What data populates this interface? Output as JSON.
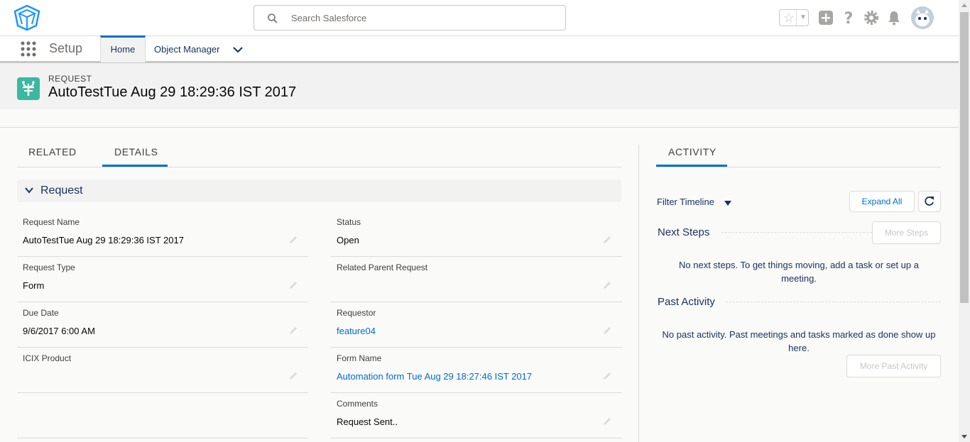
{
  "header": {
    "search_placeholder": "Search Salesforce",
    "icons": [
      "cube-logo-icon",
      "search-icon",
      "star-icon",
      "add-icon",
      "help-icon",
      "setup-gear-icon",
      "notifications-bell-icon",
      "avatar"
    ]
  },
  "context_nav": {
    "app_name": "Setup",
    "tabs": [
      {
        "label": "Home",
        "active": true
      },
      {
        "label": "Object Manager",
        "active": false
      }
    ]
  },
  "record": {
    "object_type": "REQUEST",
    "title": "AutoTestTue Aug 29 18:29:36 IST 2017"
  },
  "details_tabs": [
    {
      "label": "RELATED",
      "active": false
    },
    {
      "label": "DETAILS",
      "active": true
    }
  ],
  "section": {
    "title": "Request"
  },
  "fields_left": [
    {
      "label": "Request Name",
      "value": "AutoTestTue Aug 29 18:29:36 IST 2017",
      "link": false
    },
    {
      "label": "Request Type",
      "value": "Form",
      "link": false
    },
    {
      "label": "Due Date",
      "value": "9/6/2017 6:00 AM",
      "link": false
    },
    {
      "label": "ICIX Product",
      "value": "",
      "link": false
    }
  ],
  "fields_right": [
    {
      "label": "Status",
      "value": "Open",
      "link": false
    },
    {
      "label": "Related Parent Request",
      "value": "",
      "link": false
    },
    {
      "label": "Requestor",
      "value": "feature04",
      "link": true
    },
    {
      "label": "Form Name",
      "value": "Automation form Tue Aug 29 18:27:46 IST 2017",
      "link": true
    },
    {
      "label": "Comments",
      "value": "Request Sent..",
      "link": false
    }
  ],
  "activity": {
    "tab_label": "ACTIVITY",
    "filter_label": "Filter Timeline",
    "expand_all": "Expand All",
    "next_steps_title": "Next Steps",
    "more_steps": "More Steps",
    "next_steps_empty_line1": "No next steps. To get things moving, add a task or set up a",
    "next_steps_empty_line2": "meeting.",
    "past_activity_title": "Past Activity",
    "past_empty_line1": "No past activity. Past meetings and tasks marked as done show up",
    "past_empty_line2": "here.",
    "more_past_activity": "More Past Activity"
  },
  "colors": {
    "brand_blue": "#0070d2",
    "record_icon": "#3bb8a2",
    "link": "#006dcc"
  }
}
